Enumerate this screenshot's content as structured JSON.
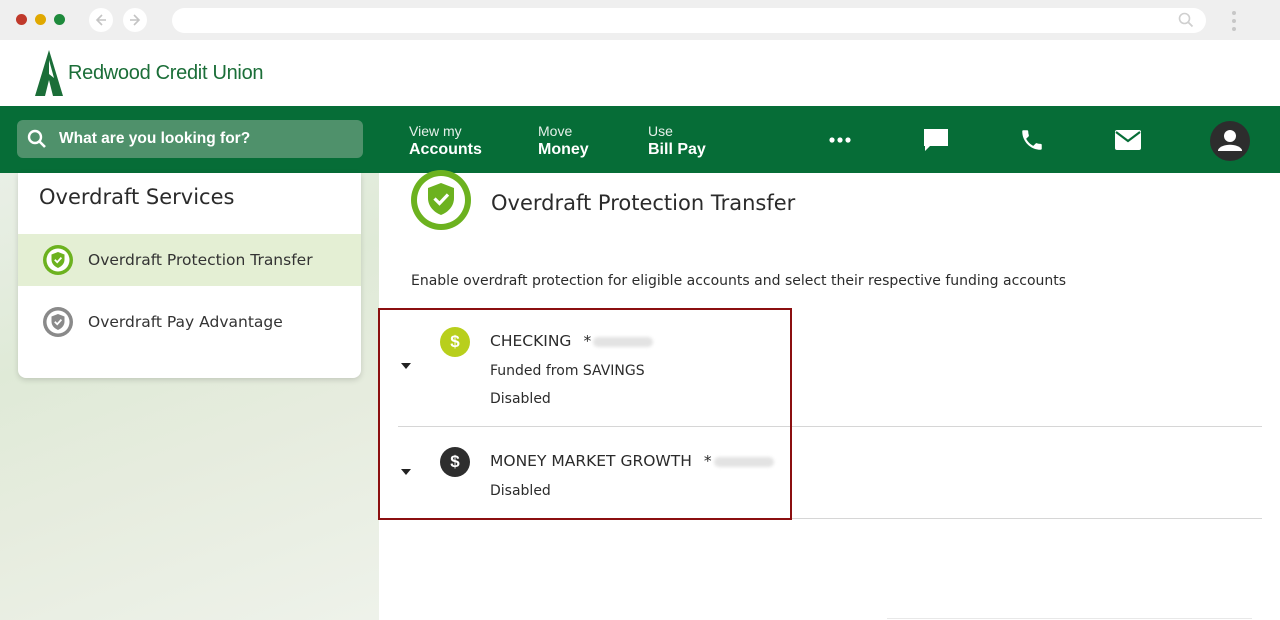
{
  "colors": {
    "brand_green": "#066d37",
    "accent_lime": "#8dc21f",
    "highlight_border": "#8b0f10"
  },
  "header": {
    "logo_text": "Redwood Credit Union"
  },
  "topnav": {
    "search_placeholder": "What are you looking for?",
    "items": [
      {
        "line1": "View my",
        "line2": "Accounts"
      },
      {
        "line1": "Move",
        "line2": "Money"
      },
      {
        "line1": "Use",
        "line2": "Bill Pay"
      }
    ],
    "icons": [
      "more-icon",
      "chat-icon",
      "phone-icon",
      "mail-icon",
      "profile-icon"
    ]
  },
  "sidebar": {
    "title": "Overdraft Services",
    "items": [
      {
        "label": "Overdraft Protection Transfer",
        "icon": "shield-check-icon",
        "active": true
      },
      {
        "label": "Overdraft Pay Advantage",
        "icon": "shield-check-icon",
        "active": false
      }
    ]
  },
  "main": {
    "title": "Overdraft Protection Transfer",
    "description": "Enable overdraft protection for eligible accounts and select their respective funding accounts",
    "accounts": [
      {
        "name": "CHECKING",
        "mask": "*",
        "funded_from": "Funded from SAVINGS",
        "status": "Disabled",
        "icon": "dollar-icon",
        "icon_color": "#b8cf1c"
      },
      {
        "name": "MONEY MARKET GROWTH",
        "mask": "*",
        "status": "Disabled",
        "icon": "dollar-icon",
        "icon_color": "#2e2e2e"
      }
    ]
  }
}
